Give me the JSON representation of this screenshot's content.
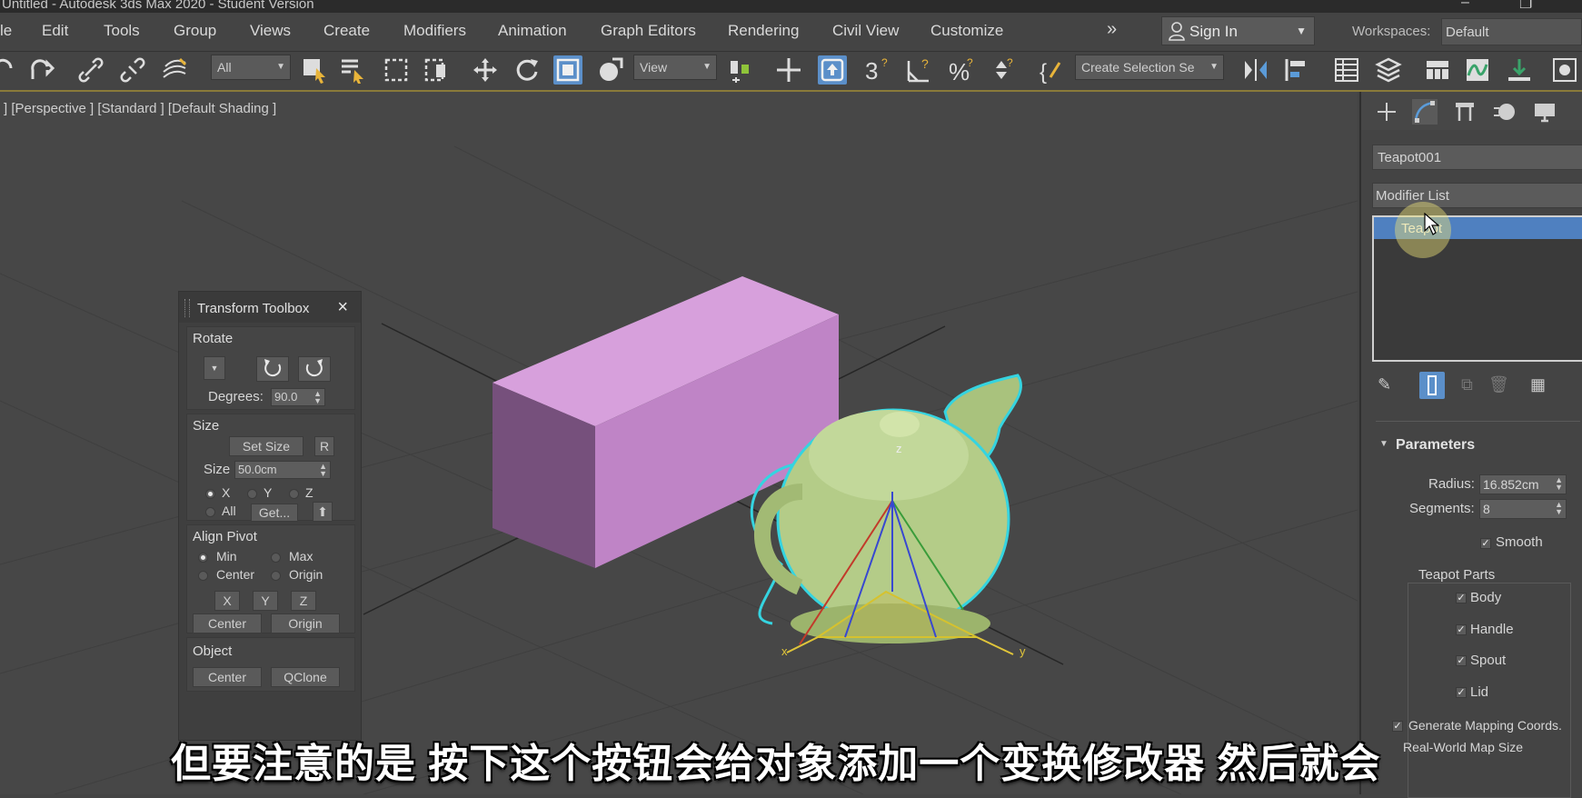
{
  "window": {
    "title": "Untitled - Autodesk 3ds Max 2020 - Student Version"
  },
  "menu": {
    "items": [
      "le",
      "Edit",
      "Tools",
      "Group",
      "Views",
      "Create",
      "Modifiers",
      "Animation",
      "Graph Editors",
      "Rendering",
      "Civil View",
      "Customize"
    ],
    "overflow": "»",
    "sign_in": "Sign In",
    "workspaces_label": "Workspaces:",
    "workspaces_value": "Default"
  },
  "toolbar": {
    "filter_value": "All",
    "coord_value": "View",
    "selection_set_placeholder": "Create Selection Se",
    "snap_angle_glyph": "3",
    "percent_glyph": "%"
  },
  "viewport": {
    "label": "] [Perspective ] [Standard ] [Default Shading ]",
    "axis_x": "x",
    "axis_y": "y",
    "axis_z": "z",
    "accent_selection": "#35d4e0",
    "box_color": "#c488cc",
    "teapot_color": "#b6cf8e"
  },
  "toolbox": {
    "title": "Transform Toolbox",
    "close": "×",
    "rotate": {
      "title": "Rotate",
      "degrees_label": "Degrees:",
      "degrees_value": "90.0"
    },
    "size": {
      "title": "Size",
      "set_size": "Set Size",
      "r": "R",
      "size_label": "Size",
      "size_value": "50.0cm",
      "x": "X",
      "y": "Y",
      "z": "Z",
      "all": "All",
      "get": "Get..."
    },
    "align_pivot": {
      "title": "Align Pivot",
      "min": "Min",
      "max": "Max",
      "center": "Center",
      "origin": "Origin",
      "x": "X",
      "y": "Y",
      "z": "Z",
      "center_btn": "Center",
      "origin_btn": "Origin"
    },
    "object": {
      "title": "Object",
      "center": "Center",
      "qclone": "QClone"
    }
  },
  "panel": {
    "object_name": "Teapot001",
    "modifier_list": "Modifier List",
    "stack_item": "Teapot",
    "parameters": {
      "title": "Parameters",
      "radius_label": "Radius:",
      "radius_value": "16.852cm",
      "segments_label": "Segments:",
      "segments_value": "8",
      "smooth": "Smooth",
      "parts_title": "Teapot Parts",
      "body": "Body",
      "handle": "Handle",
      "spout": "Spout",
      "lid": "Lid",
      "gen_mapping": "Generate Mapping Coords.",
      "real_world": "Real-World Map Size"
    }
  },
  "subtitle": "但要注意的是 按下这个按钮会给对象添加一个变换修改器 然后就会"
}
